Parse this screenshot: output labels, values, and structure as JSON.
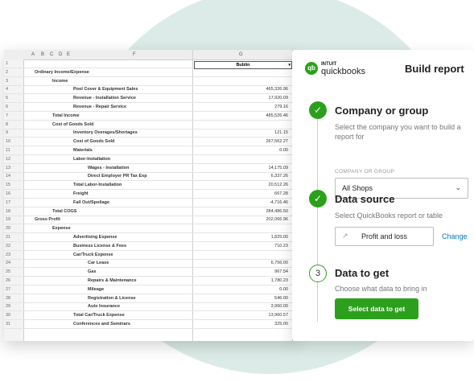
{
  "sheet": {
    "columns": [
      "A",
      "B",
      "C",
      "D",
      "E",
      "F",
      "G"
    ],
    "dropdown_value": "Bublin",
    "rows": [
      {
        "n": "1",
        "label": "",
        "value": "",
        "indent": 0
      },
      {
        "n": "2",
        "label": "Ordinary Income/Expense",
        "value": "",
        "indent": 1
      },
      {
        "n": "3",
        "label": "Income",
        "value": "",
        "indent": 2
      },
      {
        "n": "4",
        "label": "Pool Cover & Equipment Sales",
        "value": "465,326.96",
        "indent": 3
      },
      {
        "n": "5",
        "label": "Revenue - Installation Service",
        "value": "17,920.09",
        "indent": 3
      },
      {
        "n": "6",
        "label": "Revenue - Repair Service",
        "value": "279.16",
        "indent": 3
      },
      {
        "n": "7",
        "label": "Total Income",
        "value": "485,526.46",
        "indent": 2
      },
      {
        "n": "8",
        "label": "Cost of Goods Sold",
        "value": "",
        "indent": 2
      },
      {
        "n": "9",
        "label": "Inventory Overages/Shortages",
        "value": "121.15",
        "indent": 3
      },
      {
        "n": "10",
        "label": "Cost of Goods Sold",
        "value": "267,562.27",
        "indent": 3
      },
      {
        "n": "11",
        "label": "Materials",
        "value": "0.00",
        "indent": 3
      },
      {
        "n": "12",
        "label": "Labor-Installation",
        "value": "",
        "indent": 3
      },
      {
        "n": "13",
        "label": "Wages - Installation",
        "value": "14,175.09",
        "indent": 4
      },
      {
        "n": "14",
        "label": "Direct Employer PR Tax Exp",
        "value": "6,337.26",
        "indent": 4
      },
      {
        "n": "15",
        "label": "Total Labor-Installation",
        "value": "20,512.26",
        "indent": 3
      },
      {
        "n": "16",
        "label": "Freight",
        "value": "667.28",
        "indent": 3
      },
      {
        "n": "17",
        "label": "Fall Out/Spoilage",
        "value": "-4,716.46",
        "indent": 3
      },
      {
        "n": "18",
        "label": "Total COGS",
        "value": "284,486.50",
        "indent": 2
      },
      {
        "n": "19",
        "label": "Gross Profit",
        "value": "202,066.96",
        "indent": 1
      },
      {
        "n": "20",
        "label": "Expense",
        "value": "",
        "indent": 2
      },
      {
        "n": "21",
        "label": "Advertising Expense",
        "value": "1,825.00",
        "indent": 3
      },
      {
        "n": "22",
        "label": "Business License & Fees",
        "value": "710.23",
        "indent": 3
      },
      {
        "n": "23",
        "label": "Car/Truck Expense",
        "value": "",
        "indent": 3
      },
      {
        "n": "24",
        "label": "Car Lease",
        "value": "6,756.00",
        "indent": 4
      },
      {
        "n": "25",
        "label": "Gas",
        "value": "967.54",
        "indent": 4
      },
      {
        "n": "26",
        "label": "Repairs & Maintenance",
        "value": "1,780.23",
        "indent": 4
      },
      {
        "n": "27",
        "label": "Mileage",
        "value": "0.00",
        "indent": 4
      },
      {
        "n": "28",
        "label": "Registration & License",
        "value": "546.00",
        "indent": 4
      },
      {
        "n": "29",
        "label": "Auto Insurance",
        "value": "3,960.00",
        "indent": 4
      },
      {
        "n": "30",
        "label": "Total Car/Truck Expense",
        "value": "13,960.57",
        "indent": 3
      },
      {
        "n": "31",
        "label": "Conferences and Seminars",
        "value": "325.00",
        "indent": 3
      }
    ]
  },
  "panel": {
    "logo_small": "INTUIT",
    "logo_big": "quickbooks",
    "title": "Build report",
    "steps": [
      {
        "title": "Company or group",
        "desc": "Select the company you want to build a report for"
      },
      {
        "title": "Data source",
        "desc": "Select QuickBooks report or table"
      },
      {
        "number": "3",
        "title": "Data to get",
        "desc": "Choose what data to bring in"
      }
    ],
    "company_label": "COMPANY OR GROUP",
    "company_value": "All Shops",
    "report_value": "Profit and loss",
    "change_label": "Change",
    "select_button": "Select data to get"
  },
  "colors": {
    "accent": "#2ca01c",
    "link": "#0077c5",
    "background_circle": "#dcebe7"
  }
}
